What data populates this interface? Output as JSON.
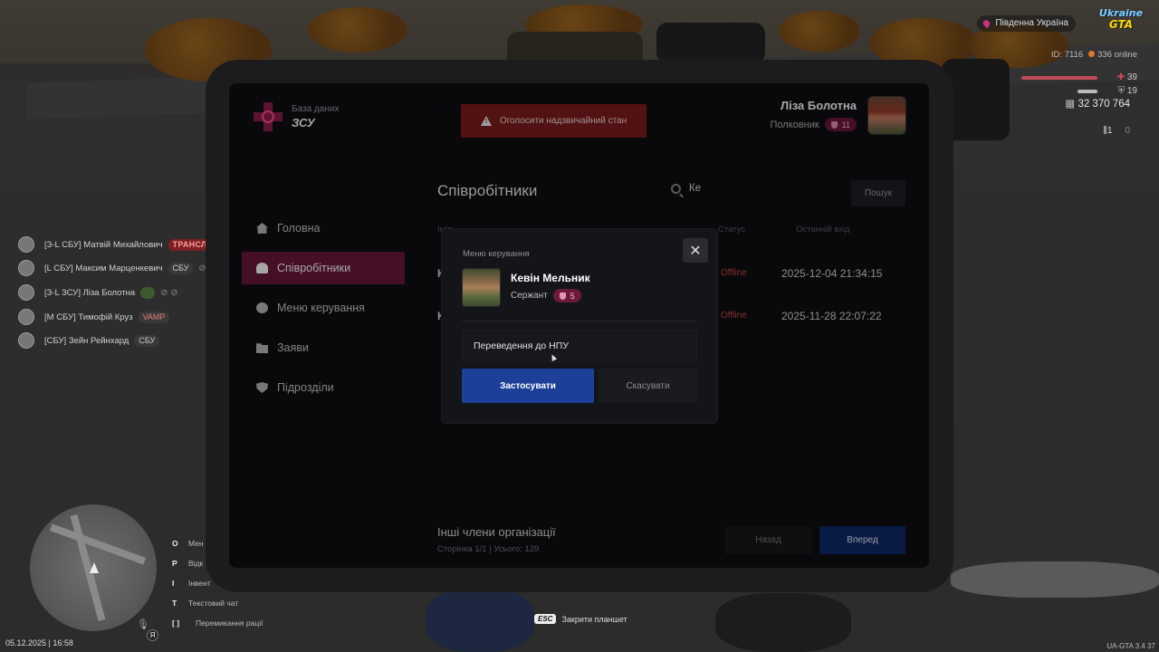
{
  "hud": {
    "region": "Південна Україна",
    "game_logo_top": "Ukraine",
    "game_logo_bottom": "GTA",
    "player_id": "ID: 7116",
    "online": "336 online",
    "health": "39",
    "armor": "19",
    "money": "32 370 764",
    "ammo_clip": "1",
    "ammo_total": "0",
    "datetime": "05.12.2025 | 16:58",
    "version": "UA-GTA 3.4",
    "version_extra": "37",
    "esc_key": "ESC",
    "esc_label": "Закрити планшет",
    "minimap_badge": "Я"
  },
  "voice_list": [
    {
      "name": "[З-L СБУ] Матвій Михайлович",
      "tag": "ТРАНСЛЯЦІЯ"
    },
    {
      "name": "[L СБУ] Максим Марценкевич",
      "tag": "СБУ"
    },
    {
      "name": "[З-L ЗСУ] Ліза Болотна",
      "tag": ""
    },
    {
      "name": "[M СБУ] Тимофій Круз",
      "tag": "VAMP"
    },
    {
      "name": "[СБУ] Зейн Рейнхард",
      "tag": "СБУ"
    }
  ],
  "binds": [
    {
      "key": "O",
      "label": "Мен"
    },
    {
      "key": "P",
      "label": "Відк"
    },
    {
      "key": "I",
      "label": "Інвент"
    },
    {
      "key": "T",
      "label": "Текстовий чат"
    },
    {
      "key": "[ ]",
      "label": "Перемикання рації"
    }
  ],
  "tablet": {
    "brand_sub": "База даних",
    "brand_name": "ЗСУ",
    "emergency_label": "Оголосити надзвичайний стан",
    "user_name": "Ліза Болотна",
    "user_rank": "Полковник",
    "user_rank_level": "11",
    "nav": [
      {
        "label": "Головна"
      },
      {
        "label": "Співробітники"
      },
      {
        "label": "Меню керування"
      },
      {
        "label": "Заяви"
      },
      {
        "label": "Підрозділи"
      }
    ],
    "section_title": "Співробітники",
    "search_query": "Ке",
    "search_button": "Пошук",
    "columns": {
      "name": "Ім'я",
      "status": "Статус",
      "last_login": "Останній вхід"
    },
    "rows": [
      {
        "name_initial": "К",
        "status": "Offline",
        "last_login": "2025-12-04 21:34:15"
      },
      {
        "name_initial": "К",
        "status": "Offline",
        "last_login": "2025-11-28 22:07:22"
      }
    ],
    "others_title": "Інші члени організації",
    "others_sub": "Сторінка 1/1 | Усього: 129",
    "back_button": "Назад",
    "next_button": "Вперед"
  },
  "modal": {
    "title": "Меню керування",
    "close_glyph": "✕",
    "employee_name": "Кевін Мельник",
    "employee_rank": "Сержант",
    "employee_rank_level": "5",
    "action_value": "Переведення до НПУ",
    "apply_button": "Застосувати",
    "cancel_button": "Скасувати"
  }
}
